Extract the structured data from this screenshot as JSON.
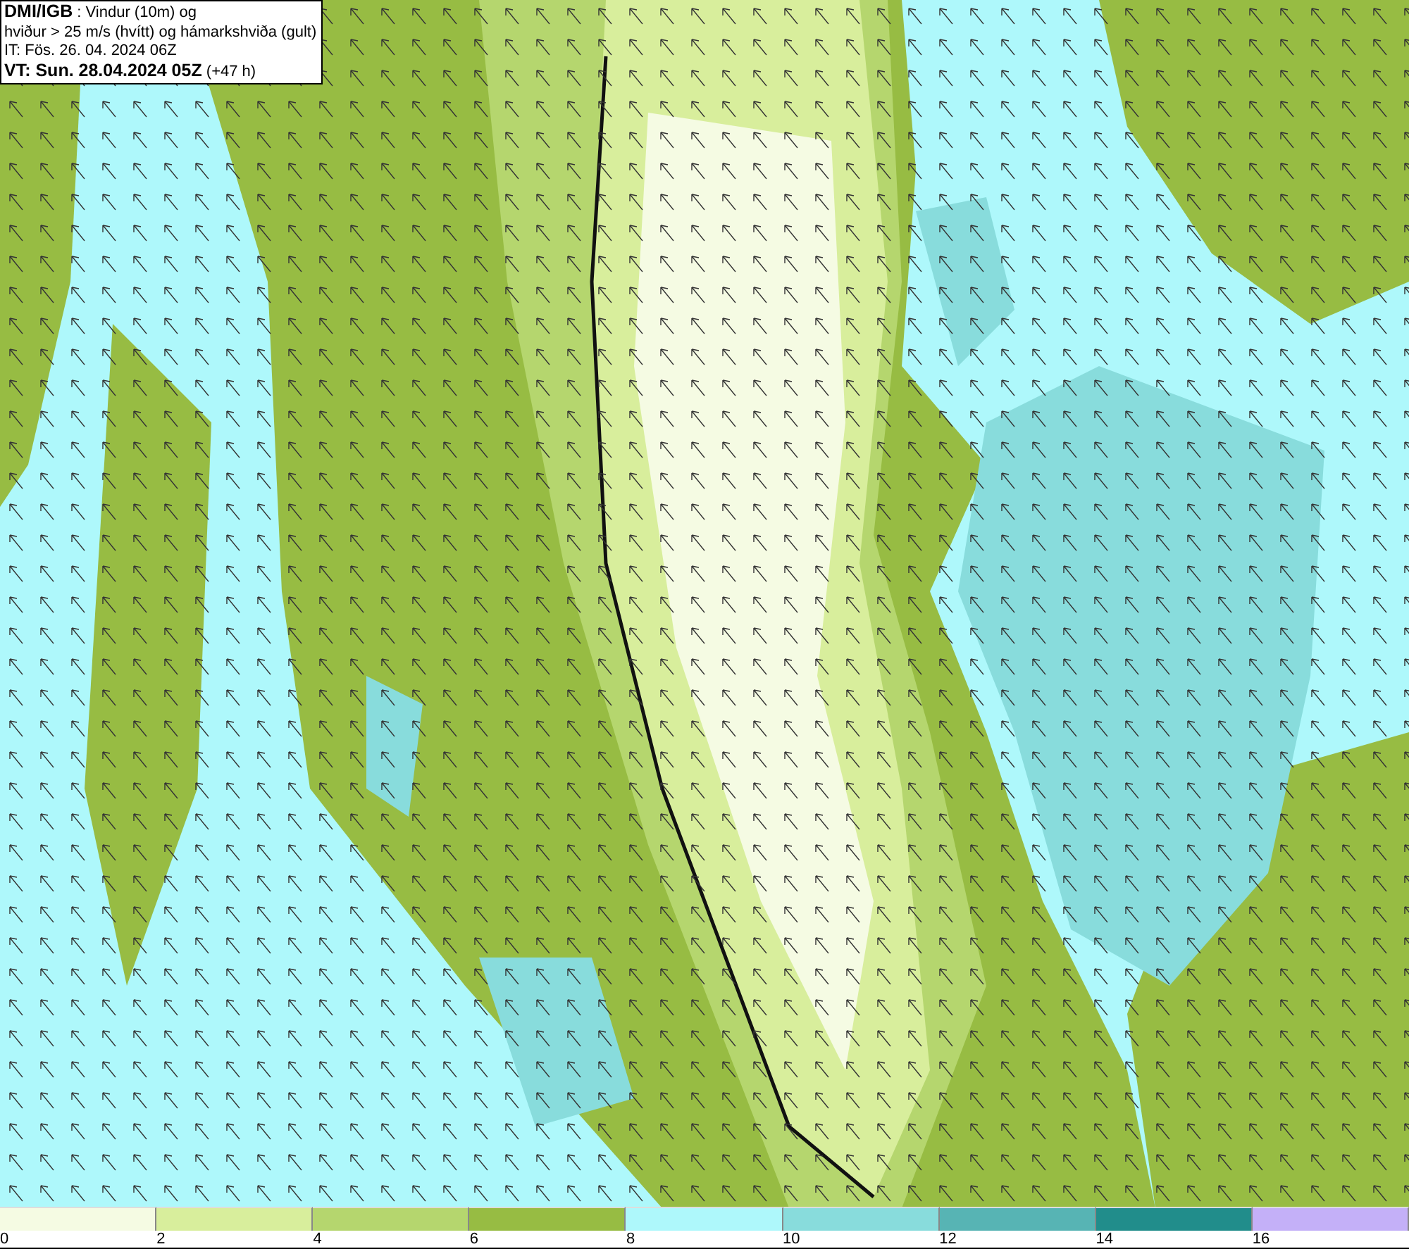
{
  "info_box": {
    "lines": [
      "**DMI/IGB** : Vindur (10m) og",
      "hviður > 25 m/s (hvítt) og hámarkshviða (gult)",
      "IT: Fös. 26. 04. 2024 06Z",
      "**VT: Sun. 28.04.2024 05Z** (+47 h)"
    ]
  },
  "legend": [
    {
      "label": "0",
      "color": "#f5fbe3"
    },
    {
      "label": "2",
      "color": "#d8ee9c"
    },
    {
      "label": "4",
      "color": "#b5d66e"
    },
    {
      "label": "6",
      "color": "#97bc43"
    },
    {
      "label": "8",
      "color": "#aef8fb"
    },
    {
      "label": "10",
      "color": "#88dcdc"
    },
    {
      "label": "12",
      "color": "#57b4b4"
    },
    {
      "label": "14",
      "color": "#218d8b"
    },
    {
      "label": "16",
      "color": "#c4b0f8"
    }
  ]
}
